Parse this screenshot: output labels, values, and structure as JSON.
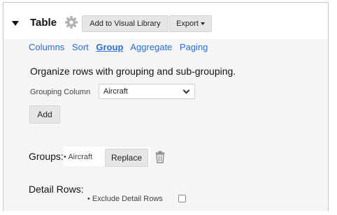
{
  "header": {
    "title": "Table",
    "add_visual_library_label": "Add to Visual Library",
    "export_label": "Export"
  },
  "tabs": [
    {
      "label": "Columns",
      "active": false
    },
    {
      "label": "Sort",
      "active": false
    },
    {
      "label": "Group",
      "active": true
    },
    {
      "label": "Aggregate",
      "active": false
    },
    {
      "label": "Paging",
      "active": false
    }
  ],
  "group_panel": {
    "description": "Organize rows with grouping and sub-grouping.",
    "grouping_column_label": "Grouping Column",
    "grouping_column_value": "Aircraft",
    "add_label": "Add",
    "groups_label": "Groups:",
    "groups": [
      {
        "name": "Aircraft"
      }
    ],
    "replace_label": "Replace",
    "detail_rows_label": "Detail Rows:",
    "exclude_detail_rows_label": "Exclude Detail Rows",
    "exclude_detail_rows_checked": false
  },
  "colors": {
    "link": "#2b6ed1",
    "panel_bg": "#f5f5f5",
    "button_bg": "#e6e6e6"
  },
  "icons": {
    "gear": "gear-icon",
    "trash": "trash-icon",
    "caret": "caret-down-icon"
  }
}
